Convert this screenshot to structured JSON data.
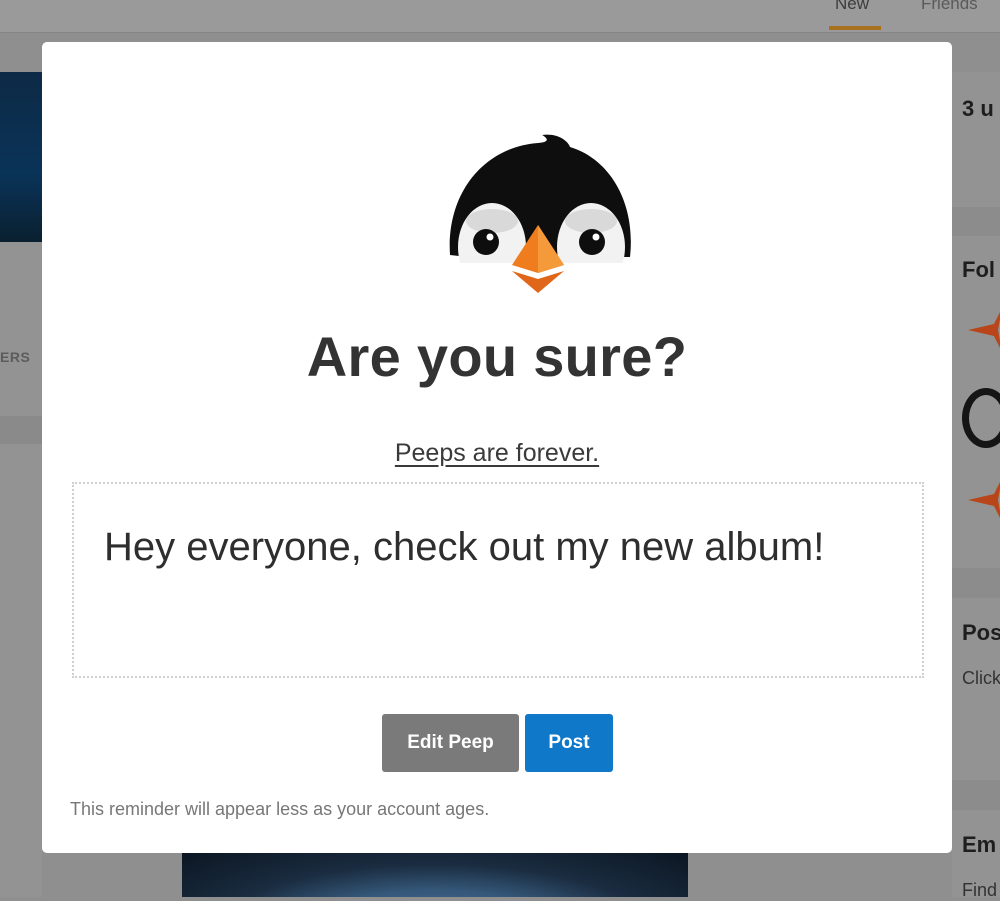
{
  "background": {
    "tabs": [
      {
        "label": "New",
        "active": true
      },
      {
        "label": "Friends",
        "active": false
      }
    ],
    "left_label": "ERS",
    "right": {
      "card1_text": "3 u",
      "card2_heading": "Fol",
      "card3_heading": "Pos",
      "card3_sub": "Click",
      "card4_heading": "Em",
      "card4_sub": "Find"
    },
    "accent_color": "#a8701f"
  },
  "modal": {
    "mascot_icon": "penguin-mascot-icon",
    "title": "Are you sure?",
    "subtitle": "Peeps are forever.",
    "peep_text": "Hey everyone, check out my new album!",
    "buttons": {
      "edit_label": "Edit Peep",
      "post_label": "Post"
    },
    "reminder": "This reminder will appear less as your account ages.",
    "colors": {
      "post_button": "#0f78c8",
      "edit_button": "#7a7a7a",
      "beak": "#ef7c1d"
    }
  }
}
